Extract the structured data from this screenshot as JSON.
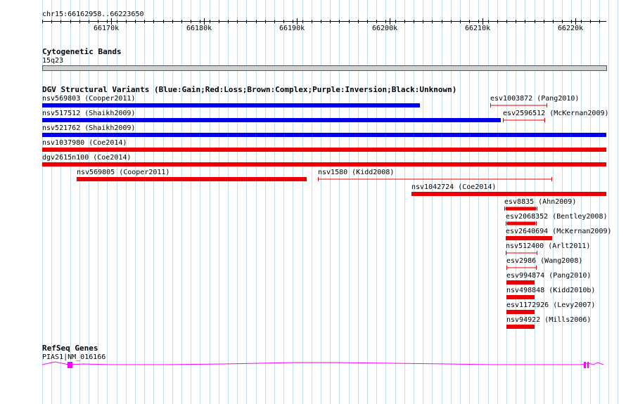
{
  "ruler": {
    "position_label": "chr15:66162958..66223650",
    "tick_labels": [
      "66170k",
      "66180k",
      "66190k",
      "66200k",
      "66210k",
      "66220k"
    ]
  },
  "cytoband": {
    "title": "Cytogenetic Bands",
    "band_label": "15q23"
  },
  "dgv": {
    "title": "DGV Structural Variants (Blue:Gain;Red:Loss;Brown:Complex;Purple:Inversion;Black:Unknown)",
    "colors": {
      "gain": "#0000ee",
      "loss": "#ee0000"
    },
    "variants": [
      {
        "id": "nsv569803",
        "label": "nsv569803 (Cooper2011)",
        "type": "gain"
      },
      {
        "id": "esv1003872",
        "label": "esv1003872 (Pang2010)",
        "type": "loss"
      },
      {
        "id": "nsv517512",
        "label": "nsv517512 (Shaikh2009)",
        "type": "gain"
      },
      {
        "id": "esv2596512",
        "label": "esv2596512 (McKernan2009)",
        "type": "loss"
      },
      {
        "id": "nsv521762",
        "label": "nsv521762 (Shaikh2009)",
        "type": "gain"
      },
      {
        "id": "nsv1037980",
        "label": "nsv1037980 (Coe2014)",
        "type": "loss"
      },
      {
        "id": "dgv2615n100",
        "label": "dgv2615n100 (Coe2014)",
        "type": "loss"
      },
      {
        "id": "nsv569805",
        "label": "nsv569805 (Cooper2011)",
        "type": "loss"
      },
      {
        "id": "nsv1580",
        "label": "nsv1580 (Kidd2008)",
        "type": "loss"
      },
      {
        "id": "nsv1042724",
        "label": "nsv1042724 (Coe2014)",
        "type": "loss"
      },
      {
        "id": "esv8835",
        "label": "esv8835 (Ahn2009)",
        "type": "loss"
      },
      {
        "id": "esv2068352",
        "label": "esv2068352 (Bentley2008)",
        "type": "loss"
      },
      {
        "id": "esv2640694",
        "label": "esv2640694 (McKernan2009)",
        "type": "loss"
      },
      {
        "id": "nsv512400",
        "label": "nsv512400 (Arlt2011)",
        "type": "loss"
      },
      {
        "id": "esv2986",
        "label": "esv2986 (Wang2008)",
        "type": "loss"
      },
      {
        "id": "esv994874",
        "label": "esv994874 (Pang2010)",
        "type": "loss"
      },
      {
        "id": "nsv498848",
        "label": "nsv498848 (Kidd2010b)",
        "type": "loss"
      },
      {
        "id": "esv1172926",
        "label": "esv1172926 (Levy2007)",
        "type": "loss"
      },
      {
        "id": "nsv94922",
        "label": "nsv94922 (Mills2006)",
        "type": "loss"
      }
    ]
  },
  "refseq": {
    "title": "RefSeq Genes",
    "gene_label": "PIAS1|NM_016166",
    "color": "#ff00ff"
  }
}
